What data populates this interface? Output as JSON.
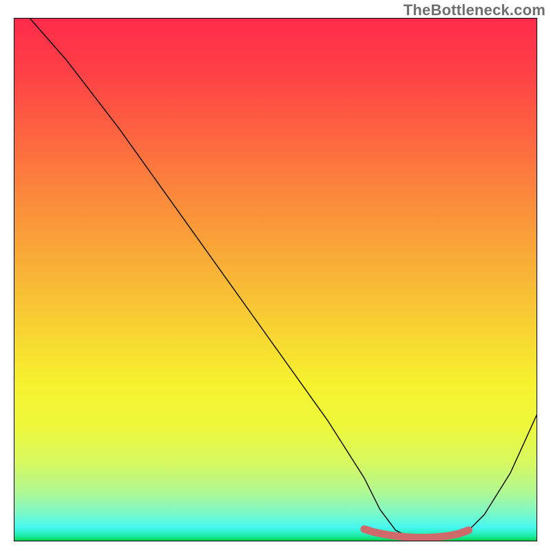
{
  "watermark": "TheBottleneck.com",
  "chart_data": {
    "type": "line",
    "title": "",
    "xlabel": "",
    "ylabel": "",
    "xlim": [
      0,
      100
    ],
    "ylim": [
      0,
      100
    ],
    "series": [
      {
        "name": "curve",
        "x": [
          3,
          10,
          15,
          20,
          30,
          40,
          50,
          60,
          67,
          70,
          73,
          76,
          80,
          84,
          87,
          90,
          95,
          100
        ],
        "y": [
          100,
          92,
          85.5,
          79,
          65,
          51,
          37,
          23,
          12,
          6,
          2,
          0.5,
          0,
          0.5,
          2,
          5,
          13,
          24
        ],
        "color": "#000000",
        "stroke_width": 1.4
      },
      {
        "name": "highlight-band",
        "x": [
          67,
          69,
          71,
          73,
          75,
          77,
          79,
          81,
          83,
          85,
          87
        ],
        "y": [
          2.2,
          1.6,
          1.2,
          0.9,
          0.7,
          0.6,
          0.6,
          0.7,
          0.9,
          1.3,
          2.0
        ],
        "color": "#d06a6a",
        "stroke_width": 11
      }
    ],
    "gradient_stops": [
      {
        "offset": 0.0,
        "color": "#fe2b4a"
      },
      {
        "offset": 0.1,
        "color": "#fe4046"
      },
      {
        "offset": 0.22,
        "color": "#fd6440"
      },
      {
        "offset": 0.34,
        "color": "#fb893c"
      },
      {
        "offset": 0.46,
        "color": "#f9ac37"
      },
      {
        "offset": 0.58,
        "color": "#f8cf33"
      },
      {
        "offset": 0.7,
        "color": "#f6f22e"
      },
      {
        "offset": 0.78,
        "color": "#eef83b"
      },
      {
        "offset": 0.85,
        "color": "#d7f85f"
      },
      {
        "offset": 0.905,
        "color": "#b3f891"
      },
      {
        "offset": 0.945,
        "color": "#7ff8c6"
      },
      {
        "offset": 0.975,
        "color": "#45f8f0"
      },
      {
        "offset": 0.992,
        "color": "#18eaa0"
      },
      {
        "offset": 1.0,
        "color": "#06d34c"
      }
    ]
  }
}
